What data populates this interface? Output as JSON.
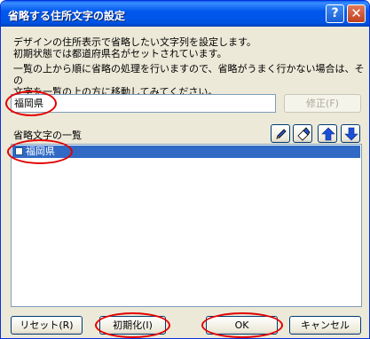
{
  "window": {
    "title": "省略する住所文字の設定",
    "help_button": "?",
    "close_button": "✕"
  },
  "description": {
    "line1": "デザインの住所表示で省略したい文字列を設定します。",
    "line2": "初期状態では都道府県名がセットされています。",
    "line3": "一覧の上から順に省略の処理を行いますので、省略がうまく行かない場合は、その",
    "line4": "文字を一覧の上の方に移動してみてください。"
  },
  "input": {
    "value": "福岡県",
    "edit_label": "修正(F)"
  },
  "list": {
    "label": "省略文字の一覧",
    "items": [
      {
        "label": "福岡県",
        "selected": true
      }
    ],
    "tools": [
      "edit-icon",
      "eraser-icon",
      "arrow-up-icon",
      "arrow-down-icon"
    ]
  },
  "footer": {
    "reset_label": "リセット(R)",
    "init_label": "初期化(I)",
    "ok_label": "OK",
    "cancel_label": "キャンセル"
  },
  "colors": {
    "titlebar": "#0054e3",
    "selection": "#316ac5",
    "highlight_circle": "#e30000",
    "dialog_bg": "#ece9d8"
  }
}
